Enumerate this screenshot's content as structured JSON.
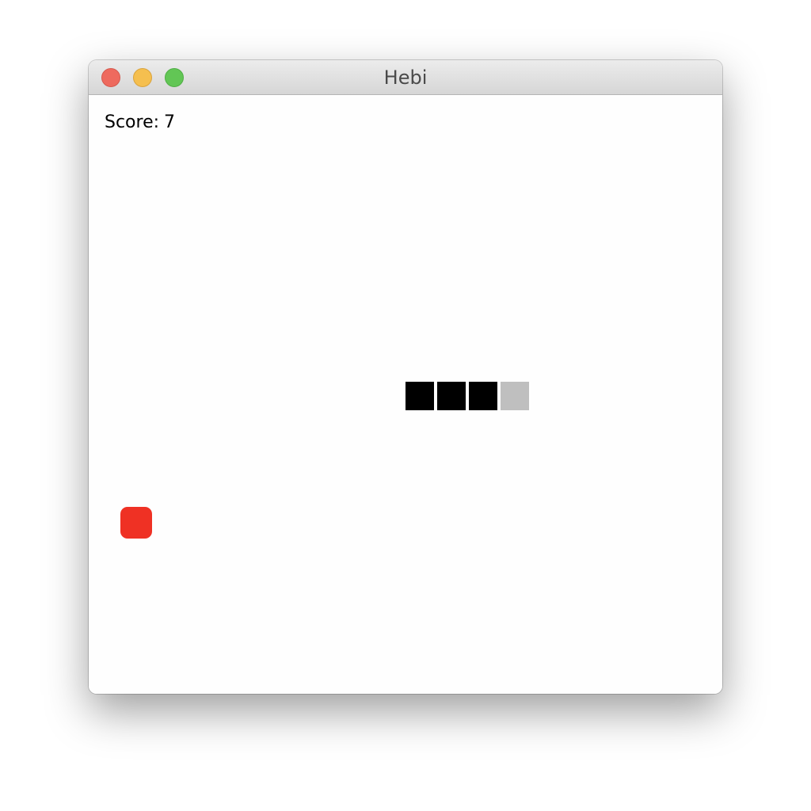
{
  "window": {
    "title": "Hebi"
  },
  "hud": {
    "score_label": "Score:",
    "score_value": "7"
  },
  "colors": {
    "snake_body": "#000000",
    "snake_tail": "#bfbfbf",
    "food": "#ef3124"
  },
  "grid": {
    "cell": 40,
    "columns": 20,
    "rows": 19
  },
  "snake": {
    "segments": [
      {
        "col": 10,
        "row": 9,
        "kind": "body"
      },
      {
        "col": 11,
        "row": 9,
        "kind": "body"
      },
      {
        "col": 12,
        "row": 9,
        "kind": "body"
      },
      {
        "col": 13,
        "row": 9,
        "kind": "tail"
      }
    ]
  },
  "food": {
    "col": 1,
    "row": 13
  }
}
